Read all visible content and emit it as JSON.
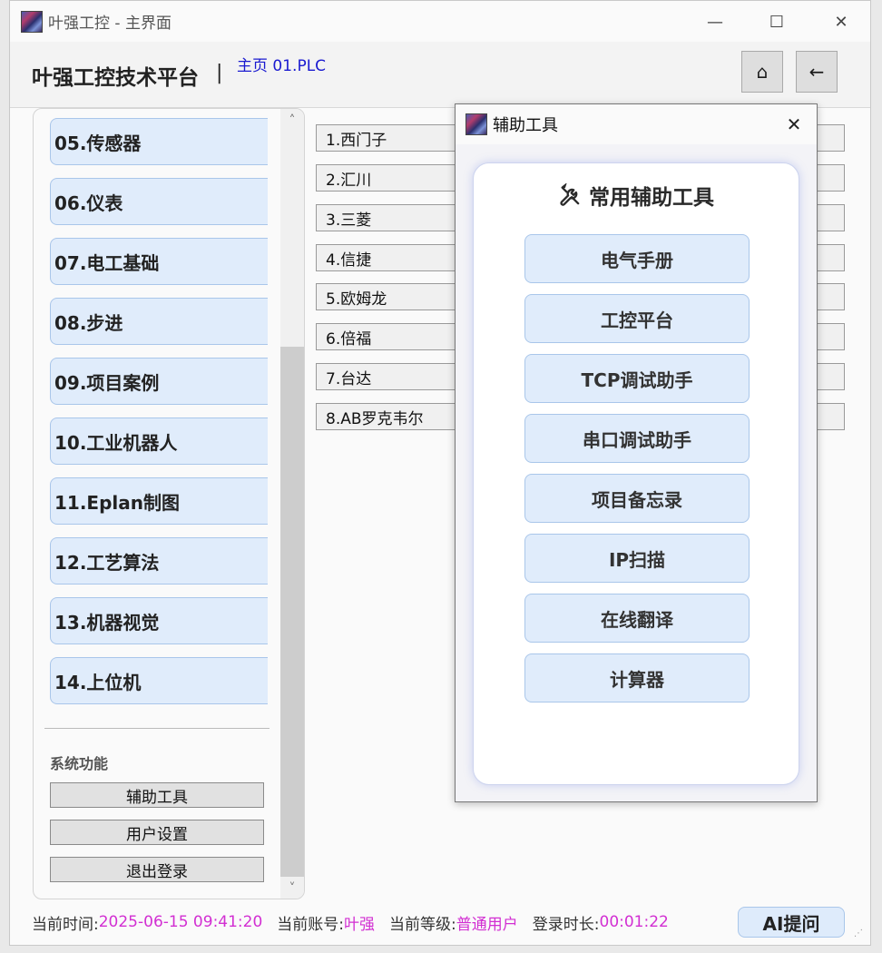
{
  "window": {
    "title": "叶强工控 - 主界面",
    "minimize_icon": "—",
    "maximize_icon": "☐",
    "close_icon": "✕"
  },
  "header": {
    "brand": "叶强工控技术平台",
    "separator": "|",
    "breadcrumb": "主页 01.PLC",
    "home_icon": "⌂",
    "back_icon": "←"
  },
  "sidebar": {
    "items": [
      {
        "label": "05.传感器"
      },
      {
        "label": "06.仪表"
      },
      {
        "label": "07.电工基础"
      },
      {
        "label": "08.步进"
      },
      {
        "label": "09.项目案例"
      },
      {
        "label": "10.工业机器人"
      },
      {
        "label": "11.Eplan制图"
      },
      {
        "label": "12.工艺算法"
      },
      {
        "label": "13.机器视觉"
      },
      {
        "label": "14.上位机"
      }
    ],
    "system_label": "系统功能",
    "system_buttons": [
      {
        "label": "辅助工具"
      },
      {
        "label": "用户设置"
      },
      {
        "label": "退出登录"
      }
    ],
    "scroll_up": "˄",
    "scroll_down": "˅"
  },
  "main": {
    "brands": [
      {
        "label": "1.西门子"
      },
      {
        "label": "2.汇川"
      },
      {
        "label": "3.三菱"
      },
      {
        "label": "4.信捷"
      },
      {
        "label": "5.欧姆龙"
      },
      {
        "label": "6.倍福"
      },
      {
        "label": "7.台达"
      },
      {
        "label": "8.AB罗克韦尔"
      }
    ]
  },
  "status": {
    "time_label": "当前时间:",
    "time_value": "2025-06-15 09:41:20",
    "account_label": "当前账号:",
    "account_value": "叶强",
    "level_label": "当前等级:",
    "level_value": "普通用户",
    "duration_label": "登录时长:",
    "duration_value": "00:01:22",
    "ai_button": "AI提问",
    "value_color": "#d22fd2"
  },
  "dialog": {
    "title": "辅助工具",
    "close_icon": "✕",
    "card_title": "常用辅助工具",
    "card_icon": "tools-icon",
    "tools": [
      {
        "label": "电气手册"
      },
      {
        "label": "工控平台"
      },
      {
        "label": "TCP调试助手"
      },
      {
        "label": "串口调试助手"
      },
      {
        "label": "项目备忘录"
      },
      {
        "label": "IP扫描"
      },
      {
        "label": "在线翻译"
      },
      {
        "label": "计算器"
      }
    ]
  }
}
